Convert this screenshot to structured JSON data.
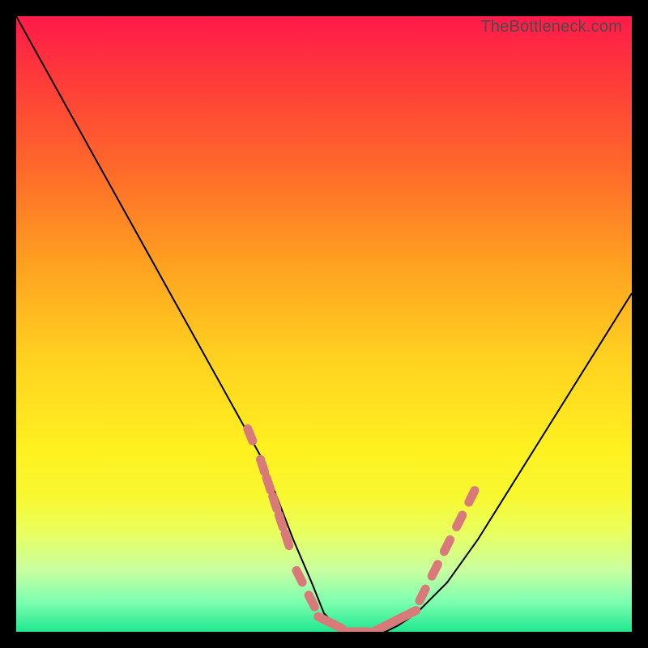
{
  "attribution": "TheBottleneck.com",
  "chart_data": {
    "type": "line",
    "title": "",
    "xlabel": "",
    "ylabel": "",
    "xlim": [
      0,
      100
    ],
    "ylim": [
      0,
      100
    ],
    "background_gradient": {
      "orientation": "vertical",
      "stops": [
        {
          "pos": 0,
          "color": "#ff1a4a"
        },
        {
          "pos": 25,
          "color": "#ff6a2a"
        },
        {
          "pos": 55,
          "color": "#ffd020"
        },
        {
          "pos": 78,
          "color": "#f8f830"
        },
        {
          "pos": 95,
          "color": "#80ffb0"
        },
        {
          "pos": 100,
          "color": "#20e890"
        }
      ]
    },
    "series": [
      {
        "name": "curve",
        "type": "line",
        "color": "#000000",
        "x": [
          0,
          5,
          10,
          15,
          20,
          25,
          30,
          35,
          40,
          45,
          48,
          50,
          52,
          55,
          58,
          60,
          62,
          65,
          70,
          75,
          80,
          85,
          90,
          95,
          100
        ],
        "values": [
          100,
          91,
          82,
          73,
          64,
          55,
          46,
          37,
          28,
          15,
          8,
          3,
          1,
          0,
          0,
          0,
          1,
          3,
          8,
          15,
          23,
          31,
          39,
          47,
          55
        ]
      },
      {
        "name": "dotted-segment-left",
        "type": "scatter",
        "color": "#d97a7a",
        "marker": "round-dash",
        "x": [
          38,
          40,
          41,
          42,
          43,
          44,
          46,
          48
        ],
        "values": [
          32,
          27,
          24,
          21,
          18,
          15,
          9,
          5
        ]
      },
      {
        "name": "dotted-segment-bottom",
        "type": "scatter",
        "color": "#d97a7a",
        "marker": "round-dash",
        "x": [
          50,
          52,
          54,
          56,
          58,
          60,
          62,
          64
        ],
        "values": [
          2,
          1,
          0,
          0,
          0,
          1,
          2,
          3
        ]
      },
      {
        "name": "dotted-segment-right",
        "type": "scatter",
        "color": "#d97a7a",
        "marker": "round-dash",
        "x": [
          66,
          68,
          70,
          72,
          74
        ],
        "values": [
          6,
          10,
          14,
          18,
          22
        ]
      }
    ]
  }
}
